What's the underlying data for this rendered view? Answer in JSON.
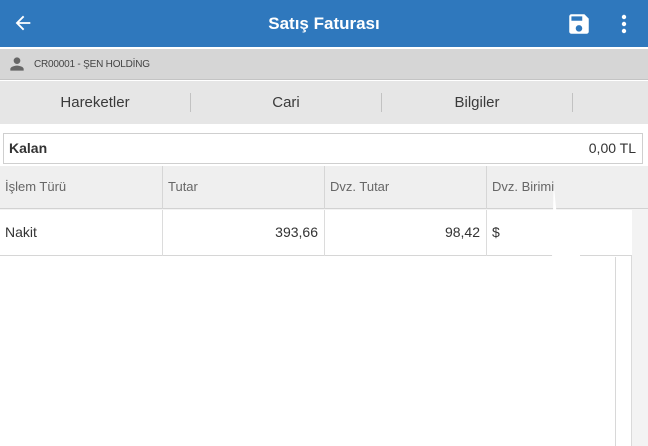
{
  "header": {
    "title": "Satış Faturası",
    "icons": {
      "back": "arrow-back-icon",
      "save": "save-icon",
      "more": "more-vert-icon"
    },
    "color": "#2f78bd"
  },
  "customer": {
    "icon": "person-icon",
    "name": "CR00001 - ŞEN HOLDİNG"
  },
  "tabs": [
    {
      "label": "Hareketler"
    },
    {
      "label": "Cari"
    },
    {
      "label": "Bilgiler"
    }
  ],
  "summary": {
    "label": "Kalan",
    "value": "0,00 TL"
  },
  "table": {
    "columns": [
      "İşlem Türü",
      "Tutar",
      "Dvz. Tutar",
      "Dvz. Birimi"
    ],
    "rows": [
      {
        "type": "Nakit",
        "amount": "393,66",
        "fx_amount": "98,42",
        "fx_unit": "$"
      }
    ]
  }
}
